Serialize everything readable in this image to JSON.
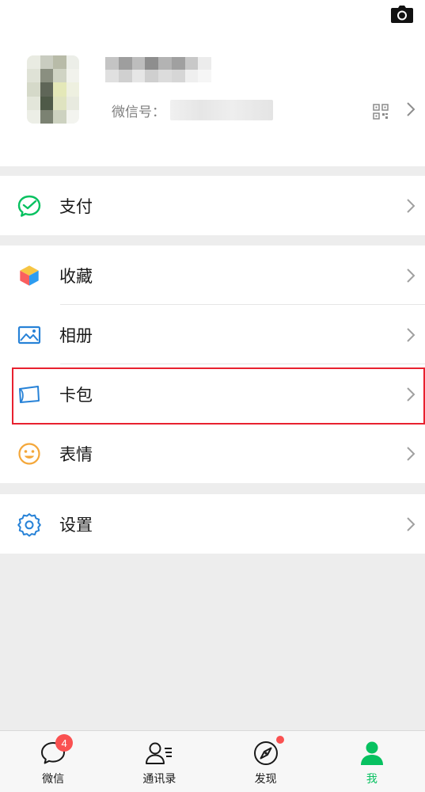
{
  "profile": {
    "wxid_label": "微信号：",
    "camera_icon": "camera-icon",
    "qr_icon": "qrcode-icon"
  },
  "menu": {
    "groups": [
      {
        "items": [
          {
            "label": "支付",
            "icon": "pay-icon",
            "color": "#07c160"
          }
        ]
      },
      {
        "items": [
          {
            "label": "收藏",
            "icon": "favorites-cube-icon"
          },
          {
            "label": "相册",
            "icon": "album-icon",
            "color": "#2782d7"
          },
          {
            "label": "卡包",
            "icon": "card-wallet-icon",
            "color": "#2782d7",
            "highlighted": true
          },
          {
            "label": "表情",
            "icon": "emoji-icon",
            "color": "#f4a73a"
          }
        ]
      },
      {
        "items": [
          {
            "label": "设置",
            "icon": "settings-gear-icon",
            "color": "#2782d7"
          }
        ]
      }
    ]
  },
  "tabbar": {
    "tabs": [
      {
        "label": "微信",
        "icon": "chat-bubble-icon",
        "badge": "4"
      },
      {
        "label": "通讯录",
        "icon": "contacts-icon"
      },
      {
        "label": "发现",
        "icon": "discover-compass-icon",
        "dot": true
      },
      {
        "label": "我",
        "icon": "me-person-icon",
        "active": true
      }
    ],
    "active_color": "#07c160",
    "badge_color": "#fa5151"
  },
  "highlight_color": "#e8212f"
}
